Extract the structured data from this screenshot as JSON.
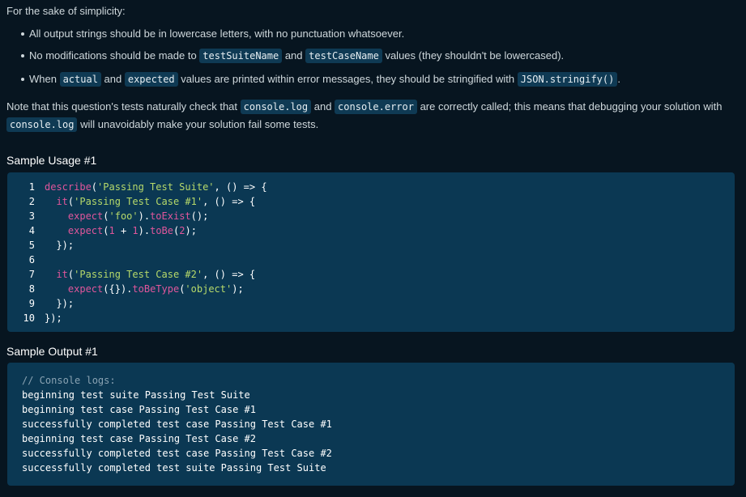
{
  "intro": "For the sake of simplicity:",
  "bullets": {
    "b1": "All output strings should be in lowercase letters, with no punctuation whatsoever.",
    "b2_pre": "No modifications should be made to ",
    "b2_code1": "testSuiteName",
    "b2_mid": " and ",
    "b2_code2": "testCaseName",
    "b2_post": " values (they shouldn't be lowercased).",
    "b3_pre": "When ",
    "b3_code1": "actual",
    "b3_mid": " and ",
    "b3_code2": "expected",
    "b3_mid2": " values are printed within error messages, they should be stringified with ",
    "b3_code3": "JSON.stringify()",
    "b3_post": "."
  },
  "note": {
    "pre": "Note that this question's tests naturally check that ",
    "code1": "console.log",
    "mid": " and ",
    "code2": "console.error",
    "mid2": " are correctly called; this means that debugging your solution with ",
    "code3": "console.log",
    "post": " will unavoidably make your solution fail some tests."
  },
  "usage_heading": "Sample Usage #1",
  "usage_lines": {
    "n1": "1",
    "n2": "2",
    "n3": "3",
    "n4": "4",
    "n5": "5",
    "n6": "6",
    "n7": "7",
    "n8": "8",
    "n9": "9",
    "n10": "10",
    "l1_fn": "describe",
    "l1_str": "'Passing Test Suite'",
    "l1_rest": ", () => {",
    "l2_fn": "it",
    "l2_str": "'Passing Test Case #1'",
    "l2_rest": ", () => {",
    "l3_fn": "expect",
    "l3_str": "'foo'",
    "l3_mid": ").",
    "l3_fn2": "toExist",
    "l3_rest": "();",
    "l4_fn": "expect",
    "l4_num1": "1",
    "l4_op": " + ",
    "l4_num2": "1",
    "l4_mid": ").",
    "l4_fn2": "toBe",
    "l4_num3": "2",
    "l4_rest": ");",
    "l5": "});",
    "l7_fn": "it",
    "l7_str": "'Passing Test Case #2'",
    "l7_rest": ", () => {",
    "l8_fn": "expect",
    "l8_obj": "({}).",
    "l8_fn2": "toBeType",
    "l8_str": "'object'",
    "l8_rest": ");",
    "l9": "});",
    "l10": "});"
  },
  "output_heading": "Sample Output #1",
  "output_lines": {
    "comment": "// Console logs:",
    "o1": "beginning test suite Passing Test Suite",
    "o2": "beginning test case Passing Test Case #1",
    "o3": "successfully completed test case Passing Test Case #1",
    "o4": "beginning test case Passing Test Case #2",
    "o5": "successfully completed test case Passing Test Case #2",
    "o6": "successfully completed test suite Passing Test Suite"
  }
}
